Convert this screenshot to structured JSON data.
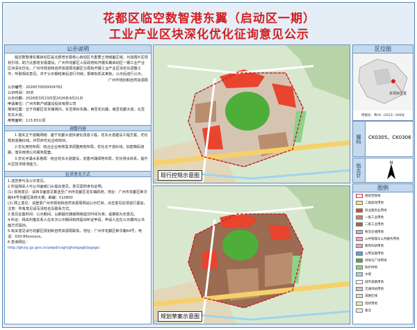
{
  "title": {
    "line1": "花都区临空数智港东翼（启动区一期）",
    "line2": "工业产业区块深化优化征询意见公示"
  },
  "notice": {
    "header": "公示说明",
    "intro": "临空数智港东翼启动区是北部增长极核心启动区与重要土地储备区域，为加强片区规划引领，助力北部增长极建设，广州市花都区人民政府拟开展东翼启动区一期工业产业区块深化优化，广州市规划和自然资源局花都区分局拟开展工业产业区块优化调整工作，听取相关意见，并于公示期结束后进行归纳，报审批机关审批，公示后进行公示。",
    "org": "广州市规划和自然资源局",
    "code_label": "公示编号：",
    "code": "2026070000009782",
    "period_label": "公示时间：",
    "period": "30天",
    "dates_label": "公示日期：",
    "dates": "2026年3月23日至2026年4月21日",
    "applicant_label": "申请单位：",
    "applicant": "广州市数产城建设投资有限公司",
    "location_label": "地块位置：",
    "location": "位于花都区花东镇境内，东至翠岭东路，西至花北路，南至花都大道，北至花东大道。",
    "area_label": "用地面积：",
    "area": "113.83公顷",
    "adjust_header": "调整内容",
    "adjust": [
      "1.落实主干道路网络：基于花都大道快速化改造工程，花东大道建设工程方案，优化规划道路红线，并同步优化边线地块。",
      "2.优化用地布局：结合企业用地需求调整用地布局，优化北干道红线，加密数码道路，落实用地公共服务配套。",
      "3.优化河涌水系格局：结合花东大道建设，完善河涌绿地布局，优化排水体系，提升片区防洪排涝能力。"
    ],
    "opinion_header": "征求意见方式",
    "opinions": [
      "1.送您参与及公示意见。",
      "2.利益相关人可以书面或口头提出意见，意见需附身份证明。",
      "(1) 现场意见：请将书面意见寄送至广州市花都区花东镇政府，地址：广州市花都区新华路64号花都区政府大楼，邮编：510800",
      "(2) 网上意见：请登录广州市规划和自然资源局网站公示栏目，点击意见反馈进行留言。",
      "注意：所有意见请写清姓名及联系方式。",
      "3.意见征集时间：公示期间，以邮戳日期或网络提交时间为准，逾期视为无意见。",
      "4.听证：相关利害关系人在本次公示期间有权提出听证申请，申请人应在公示期内以书面方式提出。",
      "5.有关意见请与花都区规划和自然资源局联系，地址：广州市花都区新华路64号，电话：020-86xxxxxx。",
      "6.查询网址：",
      "http://ghzyj.gz.gov.cn/ywpd/cxgh/ghxkgsgb/jsgsgs/"
    ]
  },
  "map_top": {
    "label": "现行控规示意图"
  },
  "map_bottom": {
    "label": "规划草案示意图"
  },
  "location_panel": {
    "header": "区位图",
    "place_label": "本项目位置",
    "code_line": "审图号：粤AS（2023）006号"
  },
  "code_panel": {
    "side_label": "编码",
    "value": "CK0305、CK0306"
  },
  "north_panel": {
    "side_label": "指北针",
    "north_letter": "N"
  },
  "legend": {
    "header": "图例",
    "items": [
      {
        "label": "规划范围线",
        "color": "#ffffff"
      },
      {
        "label": "二类居住用地",
        "color": "#f7e27a"
      },
      {
        "label": "商业服务业用地",
        "color": "#e8442e"
      },
      {
        "label": "一类工业用地",
        "color": "#b98d6e"
      },
      {
        "label": "二类工业用地",
        "color": "#9b6b52"
      },
      {
        "label": "物流仓储用地",
        "color": "#c9a6d6"
      },
      {
        "label": "公共管理与公共服务用地",
        "color": "#ff9fc0"
      },
      {
        "label": "教育科研用地",
        "color": "#e8a6b9"
      },
      {
        "label": "公用设施用地",
        "color": "#6e9bd1"
      },
      {
        "label": "绿地与广场用地",
        "color": "#4daf3a"
      },
      {
        "label": "防护绿地",
        "color": "#8fd18a"
      },
      {
        "label": "水域",
        "color": "#9fd4f0"
      },
      {
        "label": "城市道路用地",
        "color": "#ffffff"
      },
      {
        "label": "交通场站用地",
        "color": "#c6c6c6"
      },
      {
        "label": "道路红线",
        "color": "#d9d9d9"
      },
      {
        "label": "现状用地",
        "color": "#f1e0b6"
      },
      {
        "label": "备注",
        "color": "#eeeeee"
      }
    ]
  },
  "colors": {
    "title_red": "#d21f22",
    "panel_blue": "#c5d9ee"
  }
}
